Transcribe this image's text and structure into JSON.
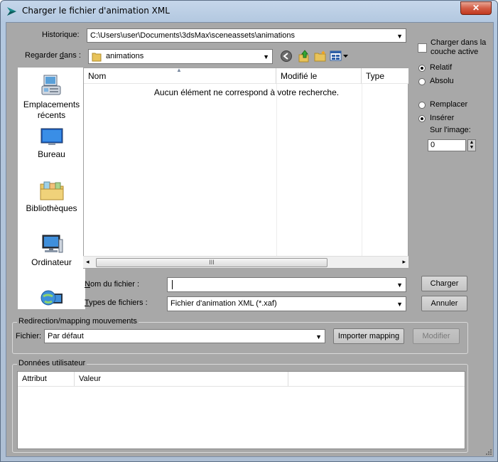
{
  "window": {
    "title": "Charger le fichier d'animation XML",
    "close_glyph": "✕"
  },
  "history": {
    "label": "Historique:",
    "value": "C:\\Users\\user\\Documents\\3dsMax\\sceneassets\\animations"
  },
  "lookin": {
    "label_prefix": "Regarder ",
    "label_mnemonic": "d",
    "label_suffix": "ans :",
    "value": "animations"
  },
  "places": [
    {
      "label": "Emplacements récents",
      "icon": "recent-places-icon"
    },
    {
      "label": "Bureau",
      "icon": "desktop-icon"
    },
    {
      "label": "Bibliothèques",
      "icon": "libraries-icon"
    },
    {
      "label": "Ordinateur",
      "icon": "computer-icon"
    },
    {
      "label": "",
      "icon": "network-icon"
    }
  ],
  "filelist": {
    "columns": [
      "Nom",
      "Modifié le",
      "Type"
    ],
    "empty_message": "Aucun élément ne correspond à votre recherche.",
    "scroll_grip": "III"
  },
  "filename": {
    "label_mnemonic": "N",
    "label_rest": "om du fichier :",
    "value": ""
  },
  "filetype": {
    "label_mnemonic": "T",
    "label_rest": "ypes de fichiers :",
    "value": "Fichier d'animation XML (*.xaf)"
  },
  "buttons": {
    "load": "Charger",
    "cancel": "Annuler",
    "import_mapping": "Importer mapping",
    "modify": "Modifier"
  },
  "options": {
    "load_active_layer": "Charger dans la couche active",
    "relative": "Relatif",
    "absolute": "Absolu",
    "replace": "Remplacer",
    "insert": "Insérer",
    "on_frame_label": "Sur l'image:",
    "on_frame_value": "0"
  },
  "retarget": {
    "group_title": "Redirection/mapping mouvements",
    "file_label": "Fichier:",
    "file_value": "Par défaut"
  },
  "userdata": {
    "group_title": "Données utilisateur",
    "columns": [
      "Attribut",
      "Valeur"
    ]
  },
  "colors": {
    "title_bg": "#b9cde5",
    "client_bg": "#a8a8a8",
    "close_btn": "#c8452c"
  }
}
